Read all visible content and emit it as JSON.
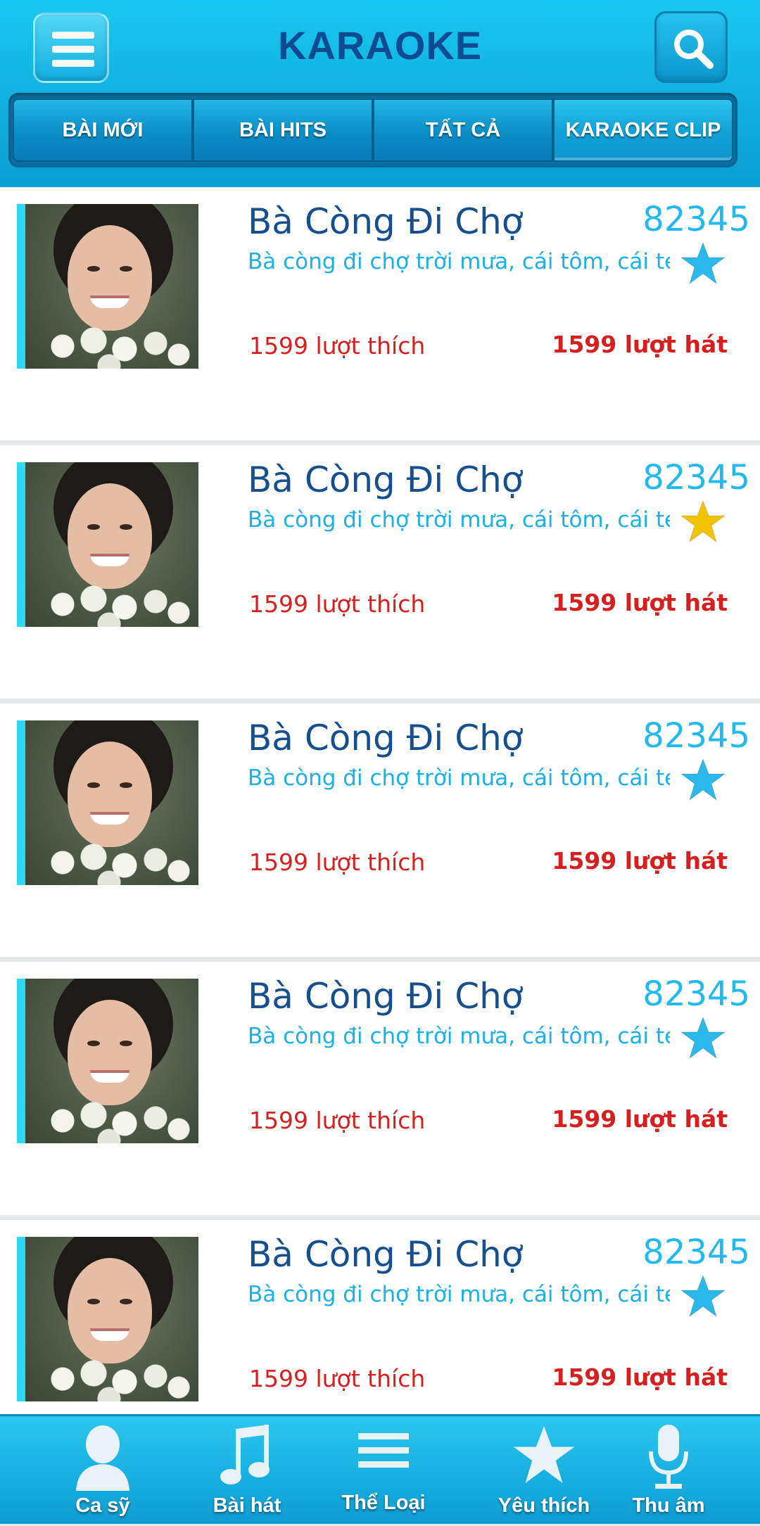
{
  "header": {
    "title": "KARAOKE",
    "menu_icon": "hamburger-icon",
    "search_icon": "search-icon"
  },
  "tabs": [
    {
      "label": "BÀI MỚI"
    },
    {
      "label": "BÀI HITS"
    },
    {
      "label": "TẤT CẢ"
    },
    {
      "label": "KARAOKE CLIP",
      "active": true
    }
  ],
  "songs": [
    {
      "title": "Bà Còng Đi Chợ",
      "number": "82345",
      "description": "Bà còng đi chợ trời mưa, cái tôm, cái tép...",
      "likes": "1599 lượt thích",
      "plays": "1599 lượt hát",
      "favorite": false
    },
    {
      "title": "Bà Còng Đi Chợ",
      "number": "82345",
      "description": "Bà còng đi chợ trời mưa, cái tôm, cái tép...",
      "likes": "1599 lượt thích",
      "plays": "1599 lượt hát",
      "favorite": true
    },
    {
      "title": "Bà Còng Đi Chợ",
      "number": "82345",
      "description": "Bà còng đi chợ trời mưa, cái tôm, cái tép...",
      "likes": "1599 lượt thích",
      "plays": "1599 lượt hát",
      "favorite": false
    },
    {
      "title": "Bà Còng Đi Chợ",
      "number": "82345",
      "description": "Bà còng đi chợ trời mưa, cái tôm, cái tép...",
      "likes": "1599 lượt thích",
      "plays": "1599 lượt hát",
      "favorite": false
    },
    {
      "title": "Bà Còng Đi Chợ",
      "number": "82345",
      "description": "Bà còng đi chợ trời mưa, cái tôm, cái tép...",
      "likes": "1599 lượt thích",
      "plays": "1599 lượt hát",
      "favorite": false
    }
  ],
  "bottom_nav": [
    {
      "label": "Ca sỹ",
      "icon": "singer-icon"
    },
    {
      "label": "Bài hát",
      "icon": "music-note-icon"
    },
    {
      "label": "Thể Loại",
      "icon": "list-icon"
    },
    {
      "label": "Yêu thích",
      "icon": "star-icon"
    },
    {
      "label": "Thu âm",
      "icon": "microphone-icon"
    }
  ],
  "colors": {
    "header_blue": "#11b4e2",
    "title_dark_blue": "#164f8e",
    "accent_cyan": "#1cb0e8",
    "count_red": "#d71f1f",
    "star_blue": "#2bb8ea",
    "star_gold": "#f2c300"
  }
}
